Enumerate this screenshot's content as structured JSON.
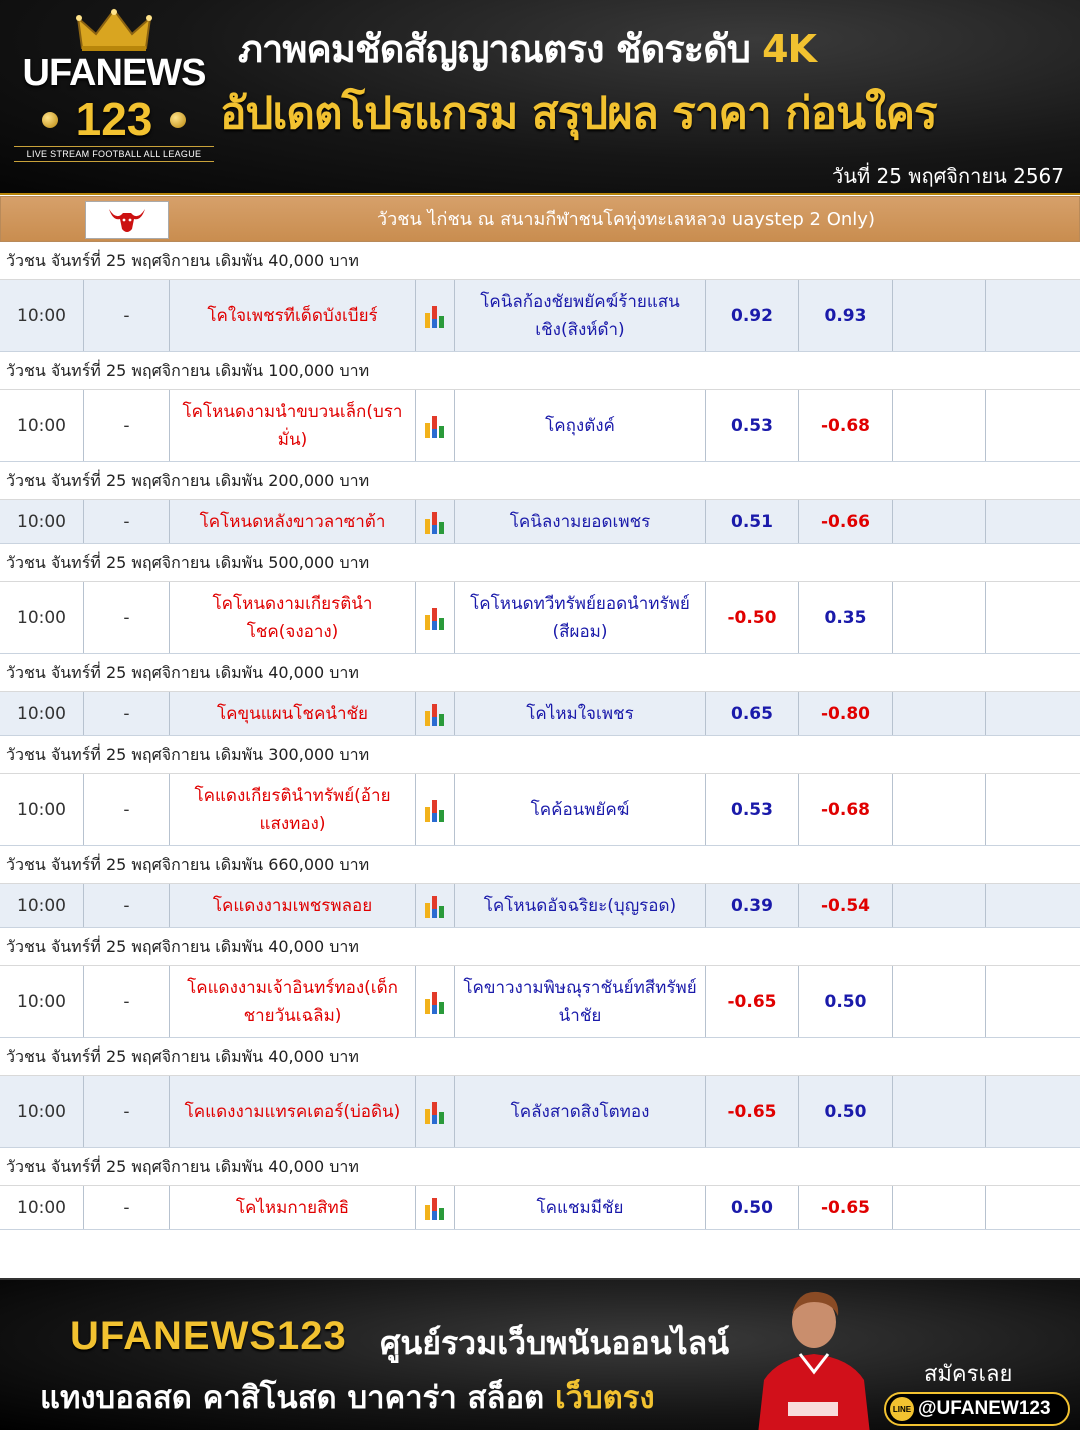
{
  "header": {
    "brand_top": "UFANEWS",
    "brand_num": "123",
    "tagline": "LIVE STREAM FOOTBALL ALL LEAGUE",
    "line1_text": "ภาพคมชัดสัญญาณตรง ชัดระดับ ",
    "line1_highlight": "4K",
    "line2": "อัปเดตโปรแกรม สรุปผล ราคา ก่อนใคร",
    "date": "วันที่ 25 พฤศจิกายน 2567"
  },
  "league": {
    "flag_icon": "bull-head-icon",
    "name": "วัวชน ไก่ชน ณ สนามกีฬาชนโคทุ่งทะเลหลวง uaystep 2 Only)"
  },
  "colors": {
    "home_team": "#e00000",
    "away_team": "#1a1aaa",
    "row_alt": "#e8eef6",
    "league_bar": "#c98d4f",
    "gold": "#f2c230"
  },
  "matches": [
    {
      "heading": "วัวชน จันทร์ที่ 25 พฤศจิกายน เดิมพัน 40,000 บาท",
      "time": "10:00",
      "dash": "-",
      "home": "โคใจเพชรทีเด็ดบังเบียร์",
      "away": "โคนิลก้องชัยพยัคฆ์ร้ายแสนเชิง(สิงห์ดำ)",
      "odds1": "0.92",
      "odds2": "0.93"
    },
    {
      "heading": "วัวชน จันทร์ที่ 25 พฤศจิกายน เดิมพัน 100,000 บาท",
      "time": "10:00",
      "dash": "-",
      "home": "โคโหนดงามนำขบวนเล็ก(บรามั่น)",
      "away": "โคถุงตังค์",
      "odds1": "0.53",
      "odds2": "-0.68"
    },
    {
      "heading": "วัวชน จันทร์ที่ 25 พฤศจิกายน เดิมพัน 200,000 บาท",
      "time": "10:00",
      "dash": "-",
      "home": "โคโหนดหลังขาวลาซาต้า",
      "away": "โคนิลงามยอดเพชร",
      "odds1": "0.51",
      "odds2": "-0.66"
    },
    {
      "heading": "วัวชน จันทร์ที่ 25 พฤศจิกายน เดิมพัน 500,000 บาท",
      "time": "10:00",
      "dash": "-",
      "home": "โคโหนดงามเกียรตินำโชค(จงอาง)",
      "away": "โคโหนดทวีทรัพย์ยอดนำทรัพย์ (สีผอม)",
      "odds1": "-0.50",
      "odds2": "0.35"
    },
    {
      "heading": "วัวชน จันทร์ที่ 25 พฤศจิกายน เดิมพัน 40,000 บาท",
      "time": "10:00",
      "dash": "-",
      "home": "โคขุนแผนโชคนำชัย",
      "away": "โคไหมใจเพชร",
      "odds1": "0.65",
      "odds2": "-0.80"
    },
    {
      "heading": "วัวชน จันทร์ที่ 25 พฤศจิกายน เดิมพัน 300,000 บาท",
      "time": "10:00",
      "dash": "-",
      "home": "โคแดงเกียรตินำทรัพย์(อ้ายแสงทอง)",
      "away": "โคค้อนพยัคฆ์",
      "odds1": "0.53",
      "odds2": "-0.68"
    },
    {
      "heading": "วัวชน จันทร์ที่ 25 พฤศจิกายน เดิมพัน 660,000 บาท",
      "time": "10:00",
      "dash": "-",
      "home": "โคแดงงามเพชรพลอย",
      "away": "โคโหนดอัจฉริยะ(บุญรอด)",
      "odds1": "0.39",
      "odds2": "-0.54"
    },
    {
      "heading": "วัวชน จันทร์ที่ 25 พฤศจิกายน เดิมพัน 40,000 บาท",
      "time": "10:00",
      "dash": "-",
      "home": "โคแดงงามเจ้าอินทร์ทอง(เด็กชายวันเฉลิม)",
      "away": "โคขาวงามพิษณุราชันย์ทสีทรัพย์นำชัย",
      "odds1": "-0.65",
      "odds2": "0.50"
    },
    {
      "heading": "วัวชน จันทร์ที่ 25 พฤศจิกายน เดิมพัน 40,000 บาท",
      "time": "10:00",
      "dash": "-",
      "home": "โคแดงงามแทรคเตอร์(บ่อดิน)",
      "away": "โคลังสาดสิงโตทอง",
      "odds1": "-0.65",
      "odds2": "0.50"
    },
    {
      "heading": "วัวชน จันทร์ที่ 25 พฤศจิกายน เดิมพัน 40,000 บาท",
      "time": "10:00",
      "dash": "-",
      "home": "โคไหมกายสิทธิ",
      "away": "โคแชมมีชัย",
      "odds1": "0.50",
      "odds2": "-0.65"
    }
  ],
  "footer": {
    "brand": "UFANEWS123",
    "slogan1": "ศูนย์รวมเว็บพนันออนไลน์",
    "slogan2_text": "แทงบอลสด คาสิโนสด บาคาร่า สล็อต ",
    "slogan2_highlight": "เว็บตรง",
    "signup": "สมัครเลย",
    "line_icon_text": "LINE",
    "line_id": "@UFANEW123"
  }
}
